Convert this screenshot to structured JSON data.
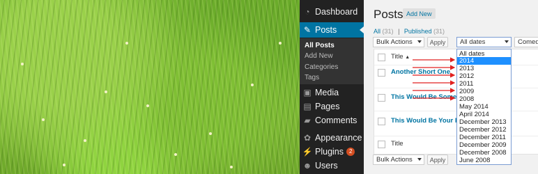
{
  "sidebar": {
    "items": [
      {
        "label": "Dashboard",
        "icon": "dashboard-icon"
      },
      {
        "label": "Posts",
        "icon": "pin-icon"
      },
      {
        "label": "Media",
        "icon": "media-icon"
      },
      {
        "label": "Pages",
        "icon": "pages-icon"
      },
      {
        "label": "Comments",
        "icon": "comments-icon"
      },
      {
        "label": "Appearance",
        "icon": "appearance-icon"
      },
      {
        "label": "Plugins",
        "icon": "plugins-icon",
        "badge": "2"
      },
      {
        "label": "Users",
        "icon": "users-icon"
      }
    ],
    "submenu": [
      "All Posts",
      "Add New",
      "Categories",
      "Tags"
    ]
  },
  "main": {
    "title": "Posts",
    "add_new": "Add New",
    "filters": {
      "all": "All",
      "all_count": "(31)",
      "published": "Published",
      "published_count": "(31)"
    },
    "bulk_actions": "Bulk Actions",
    "apply": "Apply",
    "date_filter": "All dates",
    "category_filter": "Comedy",
    "table": {
      "column_title": "Title",
      "sort_indicator": "▲",
      "posts": [
        "Another Short One",
        "This Would Be Some Bre",
        "This Would Be Your First"
      ],
      "footer_title": "Title"
    }
  },
  "date_dropdown": {
    "options": [
      "All dates",
      "2014",
      "2013",
      "2012",
      "2011",
      "2009",
      "2008",
      "May 2014",
      "April 2014",
      "December 2013",
      "December 2012",
      "December 2011",
      "December 2009",
      "December 2008",
      "June 2008"
    ],
    "selected": "2014"
  },
  "colors": {
    "sidebar": "#222222",
    "active": "#0074a2",
    "dropdown_highlight": "#1e90ff",
    "annotation_arrow": "#e02020"
  }
}
